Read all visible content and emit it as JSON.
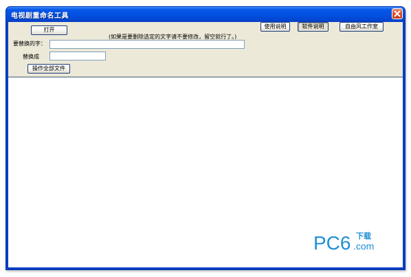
{
  "window": {
    "title": "电视剧重命名工具"
  },
  "toolbar": {
    "open_label": "打开",
    "usage_label": "使用说明",
    "software_label": "软件说明",
    "studio_label": "自由风工作室",
    "process_all_label": "操作全部文件"
  },
  "form": {
    "hint": "(如果是要删除选定的文字请不要修改，留空就行了。)",
    "find_label": "要替换的字：",
    "find_value": "",
    "replace_label": "替换成",
    "replace_value": ""
  },
  "watermark": {
    "brand": "PC6",
    "chinese": "下载",
    "suffix": ".com"
  },
  "colors": {
    "titlebar": "#0250e0",
    "window_bg": "#ece9d8",
    "close_button": "#d8532f",
    "watermark_blue": "#1f8fd6"
  },
  "icons": {
    "close": "close-x-icon"
  }
}
